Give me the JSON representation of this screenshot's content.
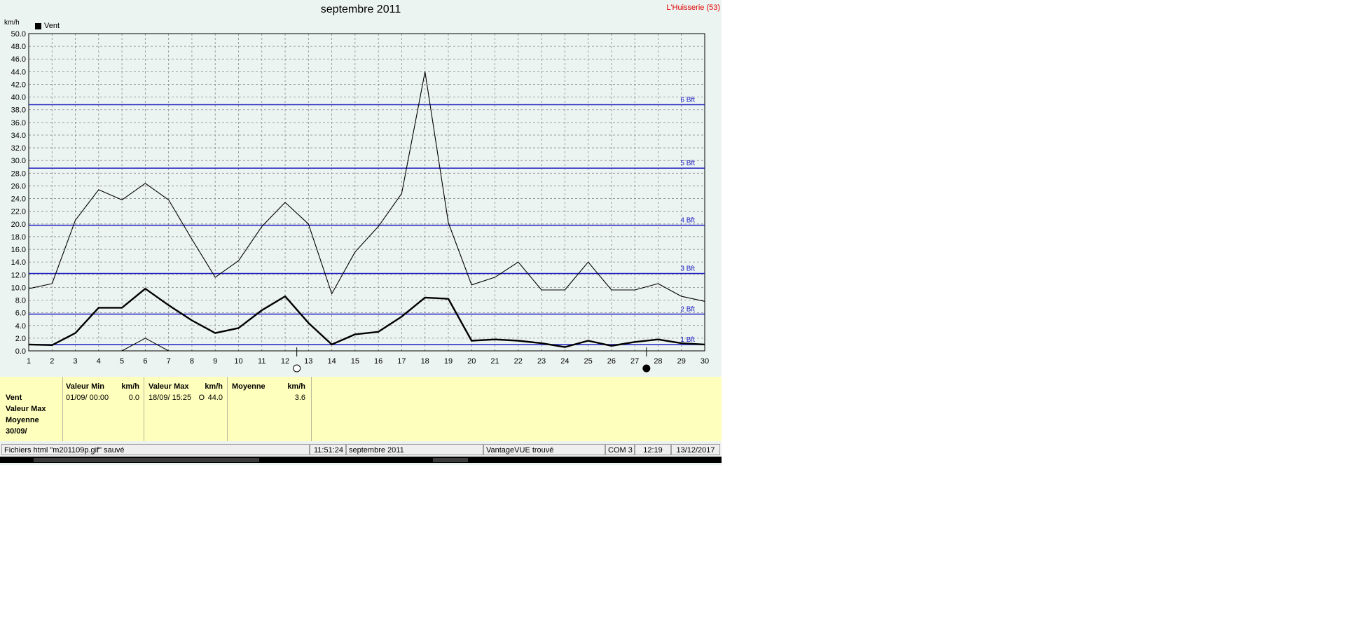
{
  "window": {
    "title": "septembre 2011",
    "station": "L'Huisserie (53)",
    "unit": "km/h",
    "legend_label": "Vent"
  },
  "colors": {
    "background": "#ecf4f2",
    "bft_line": "#2020c0",
    "station": "#e00000",
    "stats_bg": "#ffffbd"
  },
  "chart_data": {
    "type": "line",
    "title": "septembre 2011",
    "ylabel": "km/h",
    "ylim": [
      0,
      50
    ],
    "yticks": [
      "0.0",
      "2.0",
      "4.0",
      "6.0",
      "8.0",
      "10.0",
      "12.0",
      "14.0",
      "16.0",
      "18.0",
      "20.0",
      "22.0",
      "24.0",
      "26.0",
      "28.0",
      "30.0",
      "32.0",
      "34.0",
      "36.0",
      "38.0",
      "40.0",
      "42.0",
      "44.0",
      "46.0",
      "48.0",
      "50.0"
    ],
    "x": [
      1,
      2,
      3,
      4,
      5,
      6,
      7,
      8,
      9,
      10,
      11,
      12,
      13,
      14,
      15,
      16,
      17,
      18,
      19,
      20,
      21,
      22,
      23,
      24,
      25,
      26,
      27,
      28,
      29,
      30
    ],
    "grid": true,
    "series": [
      {
        "name": "Vent",
        "role": "max",
        "values": [
          9.8,
          10.6,
          20.6,
          25.4,
          23.8,
          26.4,
          23.8,
          17.6,
          11.6,
          14.2,
          19.6,
          23.4,
          20.0,
          9.0,
          15.6,
          19.6,
          24.8,
          44.0,
          20.2,
          10.4,
          11.6,
          14.0,
          9.6,
          9.6,
          14.0,
          9.6,
          9.6,
          10.6,
          8.6,
          7.8
        ]
      },
      {
        "name": "Vent",
        "role": "moyenne",
        "values": [
          1.0,
          0.9,
          2.8,
          6.8,
          6.8,
          9.8,
          7.2,
          4.8,
          2.8,
          3.6,
          6.4,
          8.6,
          4.4,
          1.0,
          2.6,
          3.0,
          5.4,
          8.4,
          8.2,
          1.6,
          1.8,
          1.6,
          1.2,
          0.6,
          1.6,
          0.8,
          1.4,
          1.8,
          1.2,
          1.0
        ]
      },
      {
        "name": "Vent",
        "role": "min",
        "values": [
          null,
          null,
          null,
          null,
          0.0,
          2.0,
          0.0,
          null,
          null,
          null,
          null,
          null,
          null,
          null,
          null,
          null,
          null,
          null,
          null,
          null,
          null,
          null,
          null,
          null,
          null,
          null,
          null,
          null,
          null,
          null
        ]
      }
    ],
    "beaufort_lines": [
      {
        "label": "1 Bft",
        "value": 1.0
      },
      {
        "label": "2 Bft",
        "value": 5.8
      },
      {
        "label": "3 Bft",
        "value": 12.2
      },
      {
        "label": "4 Bft",
        "value": 19.8
      },
      {
        "label": "5 Bft",
        "value": 28.8
      },
      {
        "label": "6 Bft",
        "value": 38.8
      }
    ],
    "moon_markers": [
      {
        "day": 12.5,
        "phase": "full"
      },
      {
        "day": 27.5,
        "phase": "new"
      }
    ]
  },
  "stats": {
    "row_labels": [
      "Vent",
      "Valeur Max",
      "Moyenne",
      "30/09/"
    ],
    "min": {
      "header": "Valeur Min",
      "unit": "km/h",
      "date": "01/09/  00:00",
      "value": "0.0"
    },
    "max": {
      "header": "Valeur Max",
      "unit": "km/h",
      "date": "18/09/  15:25",
      "dir": "O",
      "value": "44.0"
    },
    "avg": {
      "header": "Moyenne",
      "unit": "km/h",
      "value": "3.6"
    }
  },
  "statusbar": {
    "message": "Fichiers html  \"m201109p.gif\"  sauvé",
    "time": "11:51:24",
    "period": "septembre 2011",
    "console": "VantageVUE trouvé",
    "port": "COM 3",
    "clock": "12:19",
    "date": "13/12/2017"
  }
}
